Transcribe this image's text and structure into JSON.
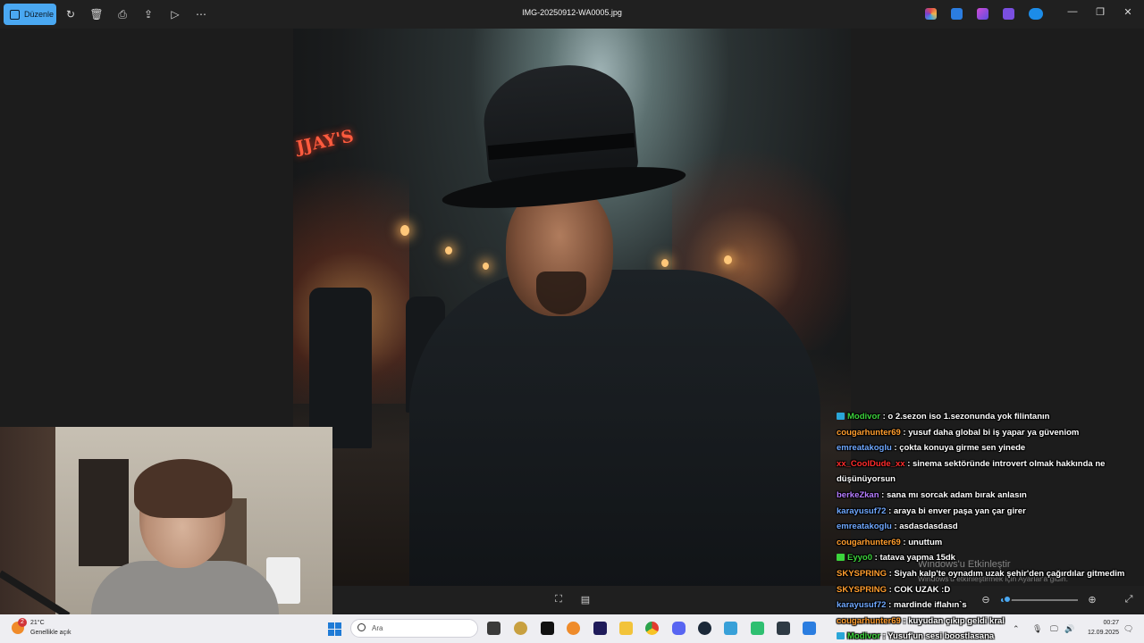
{
  "window": {
    "file_name": "IMG-20250912-WA0005.jpg",
    "edit_button_label": "Düzenle"
  },
  "toolbar_icons": [
    "rotate-icon",
    "delete-icon",
    "print-icon",
    "share-icon",
    "slideshow-icon",
    "more-icon"
  ],
  "photo": {
    "sign_text": "JJAY'S"
  },
  "viewer_bar": {
    "zoom_percent": 8
  },
  "chat": {
    "username_colors": {
      "green": "#3cd43c",
      "orange": "#ff9d2e",
      "blue": "#6fa8ff",
      "red": "#ff2b2b",
      "purple": "#b57cff"
    },
    "messages": [
      {
        "user": "Modivor",
        "color": "#3cd43c",
        "text": ": o 2.sezon iso 1.sezonunda yok filintanın",
        "badge": "#2aa6d8"
      },
      {
        "user": "cougarhunter69",
        "color": "#ff9d2e",
        "text": ": yusuf daha global bi iş yapar ya güveniom"
      },
      {
        "user": "emreatakoglu",
        "color": "#6fa8ff",
        "text": ": çokta konuya girme sen yinede"
      },
      {
        "user": "xx_CoolDude_xx",
        "color": "#ff2b2b",
        "text": ": sinema sektöründe introvert olmak hakkında ne düşünüyorsun"
      },
      {
        "user": "berkeZkan",
        "color": "#b57cff",
        "text": ": sana mı sorcak adam bırak anlasın"
      },
      {
        "user": "karayusuf72",
        "color": "#6fa8ff",
        "text": ": araya bi enver paşa yan çar girer"
      },
      {
        "user": "emreatakoglu",
        "color": "#6fa8ff",
        "text": ": asdasdasdasd"
      },
      {
        "user": "cougarhunter69",
        "color": "#ff9d2e",
        "text": ": unuttum"
      },
      {
        "user": "Eyyo0",
        "color": "#3cd43c",
        "text": ": tatava yapma 15dk",
        "badge": "#3cd43c"
      },
      {
        "user": "SKYSPRING",
        "color": "#ff9d2e",
        "text": ": Siyah kalp'te oynadım uzak şehir'den çağırdılar gitmedim"
      },
      {
        "user": "SKYSPRING",
        "color": "#ff9d2e",
        "text": ": COK UZAK :D"
      },
      {
        "user": "karayusuf72",
        "color": "#6fa8ff",
        "text": ": mardinde iflahın`s"
      },
      {
        "user": "cougarhunter69",
        "color": "#ff9d2e",
        "text": ": kuyudan çıkıp geldi kral"
      },
      {
        "user": "Modivor",
        "color": "#3cd43c",
        "text": ": Yusuf'un sesi boostlasana",
        "badge": "#2aa6d8"
      }
    ]
  },
  "watermark": {
    "title": "Windows'u Etkinleştir",
    "subtitle": "Windows'u etkinleştirmek için Ayarlar'a gidin."
  },
  "taskbar": {
    "weather_temp": "21°C",
    "weather_desc": "Genellikle açık",
    "weather_badge": "2",
    "search_placeholder": "Ara",
    "time": "00:27",
    "date": "12.09.2025"
  }
}
